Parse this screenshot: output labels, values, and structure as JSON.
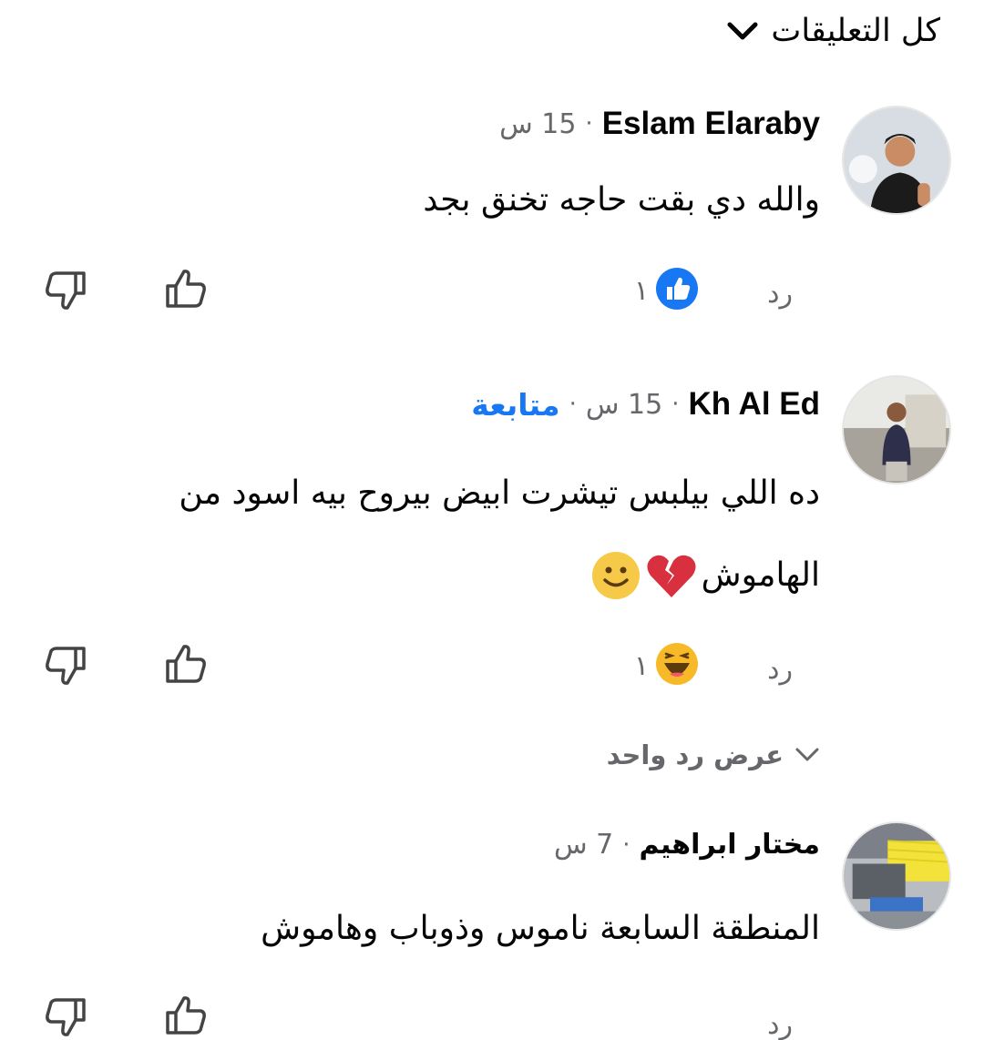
{
  "header": {
    "filter_label": "كل التعليقات"
  },
  "comments": [
    {
      "author": "Eslam Elaraby",
      "time": "15 س",
      "text": "والله دي بقت حاجه تخنق بجد",
      "reply_label": "رد",
      "reaction_count": "١",
      "reaction_icon": "like-icon"
    },
    {
      "author": "Kh Al Ed",
      "time": "15 س",
      "follow_label": "متابعة",
      "text_line1": "ده اللي بيلبس تيشرت ابيض بيروح بيه اسود من",
      "text_line2": "الهاموش",
      "reply_label": "رد",
      "reaction_count": "١",
      "reaction_icon": "haha-icon",
      "view_replies_label": "عرض رد واحد"
    },
    {
      "author": "مختار ابراهيم",
      "time": "7 س",
      "text": "المنطقة السابعة ناموس وذوباب وهاموش",
      "reply_label": "رد"
    }
  ],
  "colors": {
    "text": "#050505",
    "secondary": "#65676b",
    "accent": "#1877f2",
    "like_blue": "#1877f2",
    "haha_yellow": "#f7b928"
  }
}
